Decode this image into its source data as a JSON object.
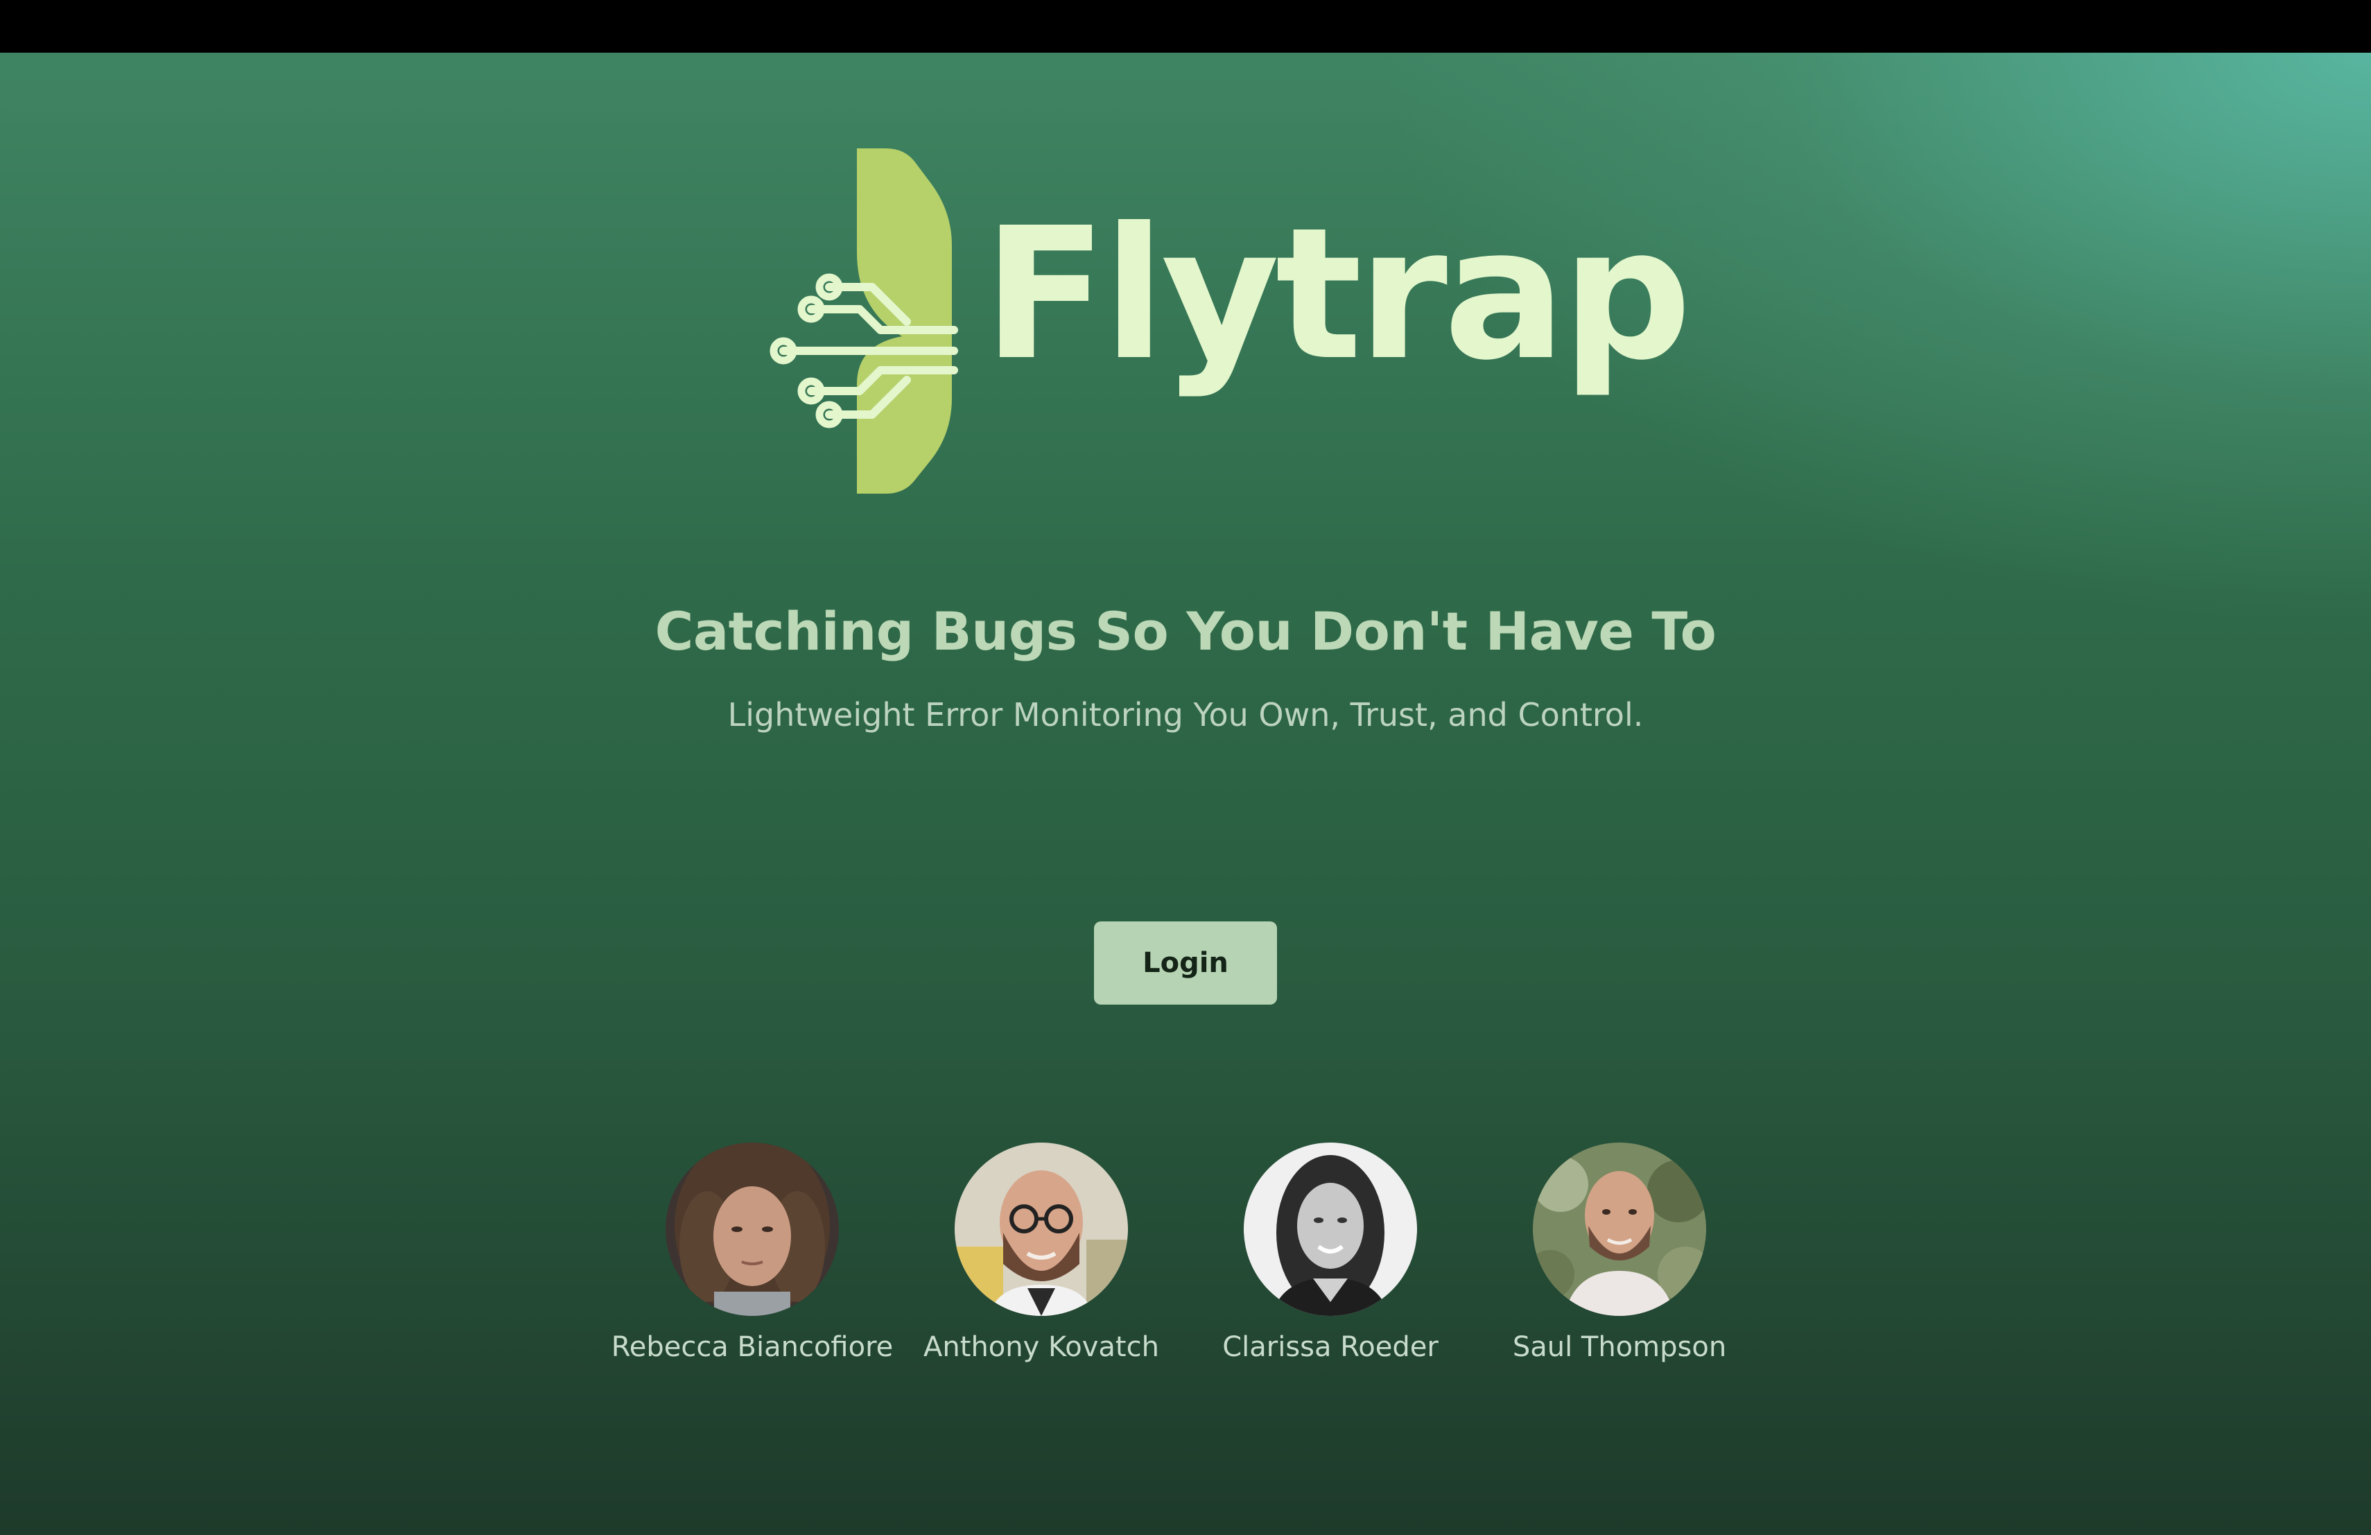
{
  "brand": {
    "name": "Flytrap",
    "logo_icon": "circuit-leaf-icon",
    "colors": {
      "wordmark": "#e3f6cc",
      "leaf": "#b6d06a",
      "circuit": "#e3f6cc"
    }
  },
  "hero": {
    "headline": "Catching Bugs So You Don't Have To",
    "subheadline": "Lightweight Error Monitoring You Own, Trust, and Control."
  },
  "actions": {
    "login_label": "Login"
  },
  "team": [
    {
      "name": "Rebecca Biancofiore",
      "photo": "photo-curly-hair-woman"
    },
    {
      "name": "Anthony Kovatch",
      "photo": "photo-bald-man-glasses"
    },
    {
      "name": "Clarissa Roeder",
      "photo": "photo-woman-black-and-white"
    },
    {
      "name": "Saul Thompson",
      "photo": "photo-bald-man-beard"
    }
  ]
}
